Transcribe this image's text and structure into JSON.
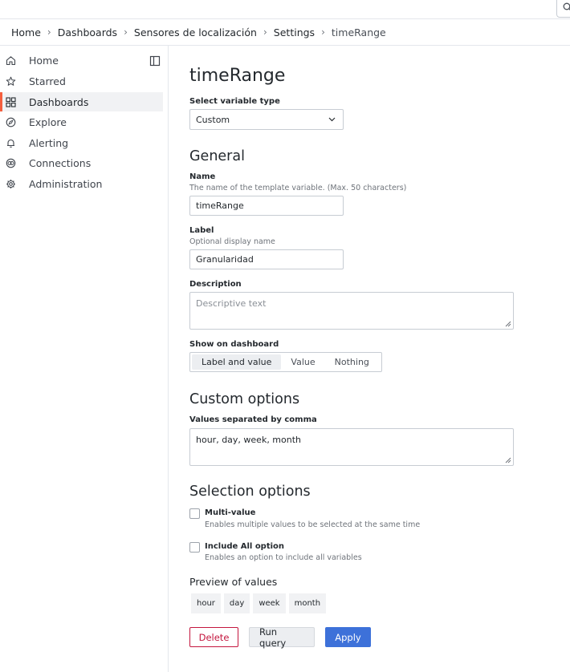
{
  "breadcrumb": {
    "items": [
      "Home",
      "Dashboards",
      "Sensores de localización",
      "Settings",
      "timeRange"
    ],
    "separator": "›"
  },
  "sidebar": {
    "items": [
      {
        "label": "Home",
        "icon": "home-icon"
      },
      {
        "label": "Starred",
        "icon": "star-icon"
      },
      {
        "label": "Dashboards",
        "icon": "dashboards-grid-icon",
        "active": true
      },
      {
        "label": "Explore",
        "icon": "compass-icon"
      },
      {
        "label": "Alerting",
        "icon": "bell-icon"
      },
      {
        "label": "Connections",
        "icon": "connections-icon"
      },
      {
        "label": "Administration",
        "icon": "gear-icon"
      }
    ],
    "accent": "#f55f3e"
  },
  "page": {
    "title": "timeRange"
  },
  "variable_type": {
    "label": "Select variable type",
    "value": "Custom"
  },
  "general": {
    "title": "General",
    "name": {
      "label": "Name",
      "description": "The name of the template variable. (Max. 50 characters)",
      "value": "timeRange"
    },
    "label_field": {
      "label": "Label",
      "description": "Optional display name",
      "value": "Granularidad"
    },
    "description": {
      "label": "Description",
      "placeholder": "Descriptive text"
    },
    "show_on_dashboard": {
      "label": "Show on dashboard",
      "options": [
        "Label and value",
        "Value",
        "Nothing"
      ],
      "selected": "Label and value"
    }
  },
  "custom_options": {
    "title": "Custom options",
    "values_label": "Values separated by comma",
    "values": "hour, day, week, month"
  },
  "selection_options": {
    "title": "Selection options",
    "multi_value": {
      "label": "Multi-value",
      "description": "Enables multiple values to be selected at the same time",
      "checked": false
    },
    "include_all": {
      "label": "Include All option",
      "description": "Enables an option to include all variables",
      "checked": false
    }
  },
  "preview": {
    "label": "Preview of values",
    "values": [
      "hour",
      "day",
      "week",
      "month"
    ]
  },
  "actions": {
    "delete": "Delete",
    "run_query": "Run query",
    "apply": "Apply",
    "danger_color": "#c4163e",
    "primary_color": "#3d71d9"
  }
}
